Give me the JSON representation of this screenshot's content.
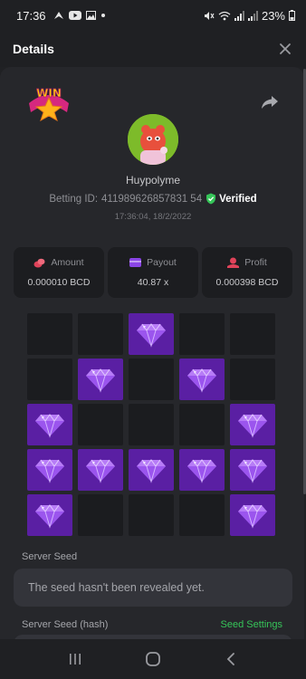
{
  "status_bar": {
    "time": "17:36",
    "battery": "23%",
    "notification_icons": [
      "navigation-icon",
      "youtube-icon",
      "gallery-icon",
      "dot-icon"
    ],
    "system_icons": [
      "mute-icon",
      "wifi-icon",
      "signal-icon",
      "signal-icon",
      "battery-icon"
    ]
  },
  "header": {
    "title": "Details",
    "close_icon": "close-icon"
  },
  "bet": {
    "badge_text": "WIN",
    "share_icon": "share-icon",
    "username": "Huypolyme",
    "betting_id_label": "Betting ID:",
    "betting_id": "411989626857831 54",
    "verified_label": "Verified",
    "datetime": "17:36:04, 18/2/2022"
  },
  "stats": [
    {
      "label": "Amount",
      "value": "0.000010 BCD",
      "icon": "coins-icon",
      "icon_color": "#e0435a"
    },
    {
      "label": "Payout",
      "value": "40.87 x",
      "icon": "card-icon",
      "icon_color": "#8b45e6"
    },
    {
      "label": "Profit",
      "value": "0.000398 BCD",
      "icon": "profit-icon",
      "icon_color": "#e0435a"
    }
  ],
  "grid": {
    "rows": 5,
    "cols": 5,
    "gems": [
      [
        0,
        0,
        1,
        0,
        0
      ],
      [
        0,
        1,
        0,
        1,
        0
      ],
      [
        1,
        0,
        0,
        0,
        1
      ],
      [
        1,
        1,
        1,
        1,
        1
      ],
      [
        1,
        0,
        0,
        0,
        1
      ]
    ],
    "gem_icon": "gem-icon"
  },
  "seeds": {
    "server_seed_label": "Server Seed",
    "server_seed_value": "The seed hasn't been revealed yet.",
    "server_seed_hash_label": "Server Seed (hash)",
    "seed_settings_label": "Seed Settings"
  },
  "nav_bar": [
    "recent-apps-icon",
    "home-icon",
    "back-icon"
  ],
  "colors": {
    "background": "#202124",
    "panel": "#26272b",
    "tile": "#1b1c1f",
    "gem_tile": "#5a1fa3",
    "accent_green": "#36c559"
  }
}
